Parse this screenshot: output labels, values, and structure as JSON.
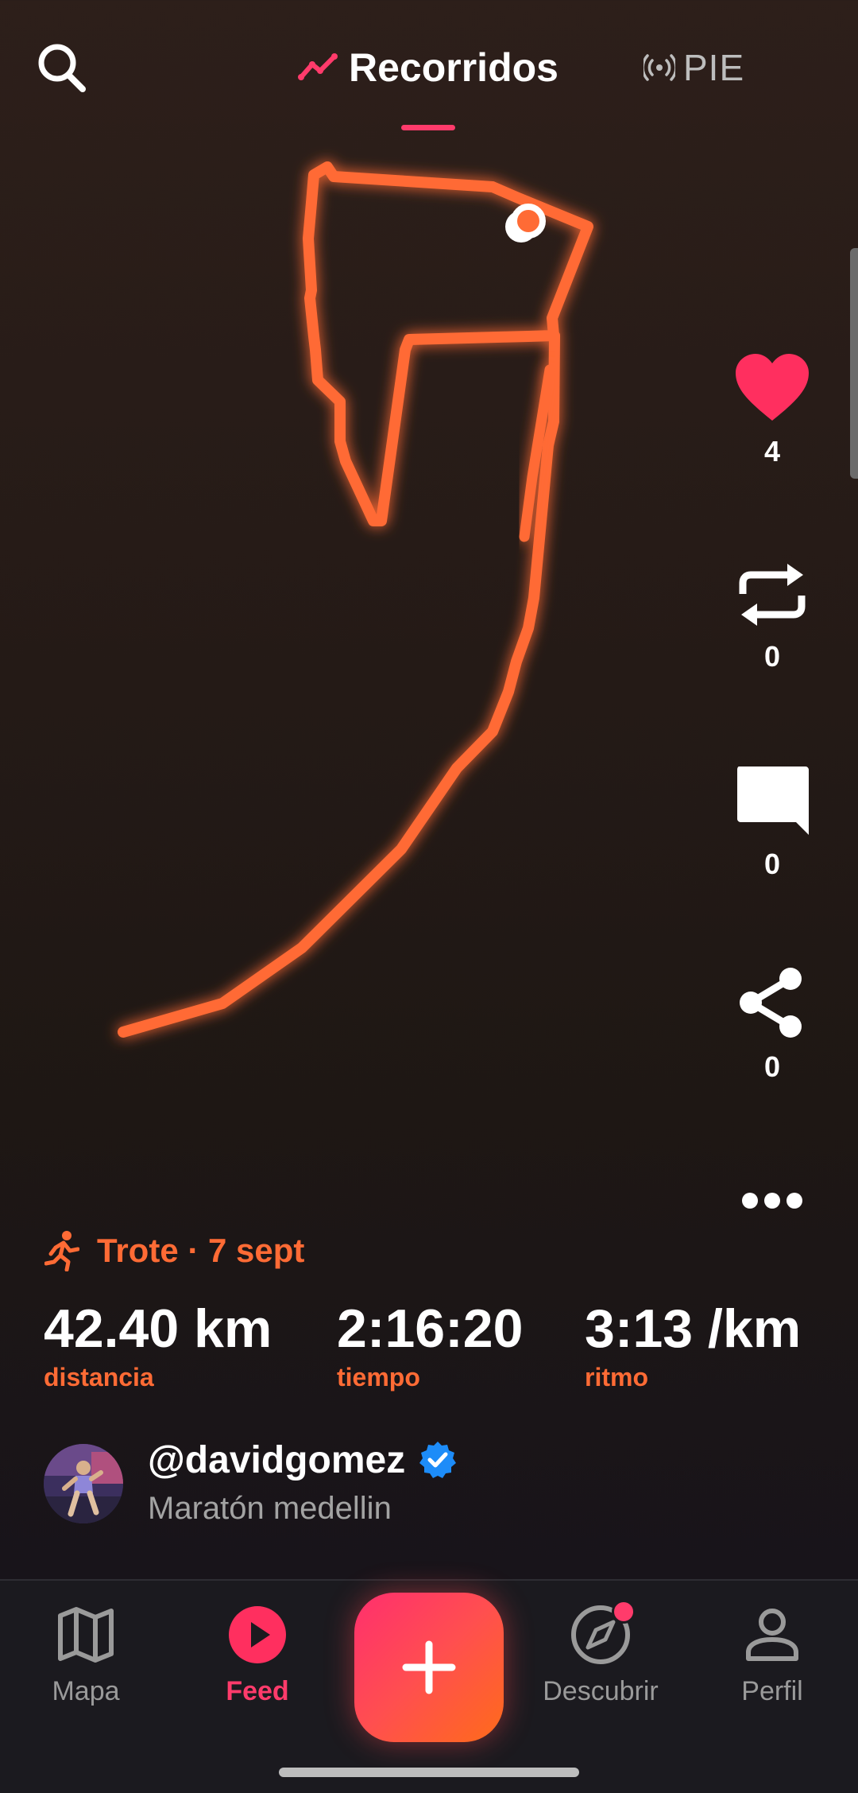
{
  "header": {
    "tabs": [
      {
        "label": "Recorridos",
        "icon": "trend-line-icon",
        "active": true
      },
      {
        "label": "PIE",
        "icon": "broadcast-icon",
        "active": false
      }
    ],
    "accent_color": "#ff3b6b"
  },
  "route": {
    "stroke_color": "#ff6b35"
  },
  "actions": {
    "likes": "4",
    "reposts": "0",
    "comments": "0",
    "shares": "0"
  },
  "activity": {
    "type_line": "Trote · 7 sept",
    "icon": "runner-icon"
  },
  "stats": [
    {
      "value": "42.40 km",
      "label": "distancia"
    },
    {
      "value": "2:16:20",
      "label": "tiempo"
    },
    {
      "value": "3:13 /km",
      "label": "ritmo"
    }
  ],
  "user": {
    "username": "@davidgomez",
    "verified": true,
    "caption": "Maratón medellin"
  },
  "nav": {
    "items": [
      {
        "label": "Mapa",
        "icon": "map-icon"
      },
      {
        "label": "Feed",
        "icon": "play-icon",
        "active": true
      },
      {
        "label": "Descubrir",
        "icon": "compass-icon",
        "badge": true
      },
      {
        "label": "Perfil",
        "icon": "person-icon"
      }
    ],
    "create_icon": "plus-icon"
  }
}
